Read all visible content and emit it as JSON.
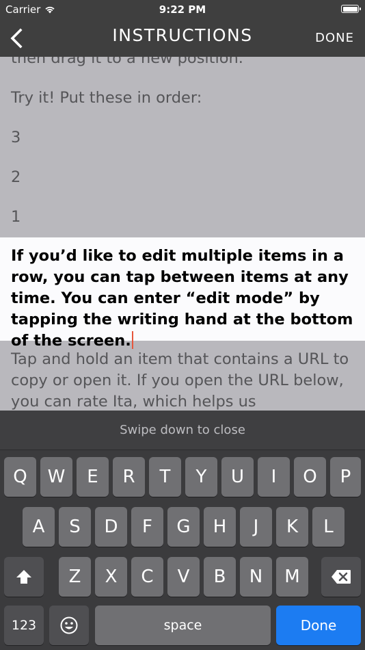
{
  "status_bar": {
    "carrier": "Carrier",
    "time": "9:22 PM"
  },
  "nav": {
    "title": "INSTRUCTIONS",
    "done_label": "DONE"
  },
  "items": [
    {
      "text": "then drag it to a new position."
    },
    {
      "text": "Try it! Put these in order:"
    },
    {
      "text": "3"
    },
    {
      "text": "2"
    },
    {
      "text": "1"
    },
    {
      "text": "If you’d like to edit multiple items in a row, you can tap between items at any time. You can enter “edit mode” by tapping the writing hand at the bottom of the screen.",
      "editing": true
    },
    {
      "text": "Tap and hold an item that contains a URL to copy or open it. If you open the URL below, you can rate Ita, which helps us"
    }
  ],
  "keyboard": {
    "hint": "Swipe down to close",
    "row1": [
      "Q",
      "W",
      "E",
      "R",
      "T",
      "Y",
      "U",
      "I",
      "O",
      "P"
    ],
    "row2": [
      "A",
      "S",
      "D",
      "F",
      "G",
      "H",
      "J",
      "K",
      "L"
    ],
    "row3": [
      "Z",
      "X",
      "C",
      "V",
      "B",
      "N",
      "M"
    ],
    "shift_icon": "shift-arrow-icon",
    "delete_icon": "backspace-icon",
    "numbers_label": "123",
    "emoji_icon": "emoji-face-icon",
    "space_label": "space",
    "done_label": "Done"
  },
  "colors": {
    "accent": "#1c7cf2",
    "caret": "#e6563c",
    "bar": "#3f3f3f",
    "content_bg": "#b9b8bd",
    "active_bg": "#fbfbfd"
  }
}
